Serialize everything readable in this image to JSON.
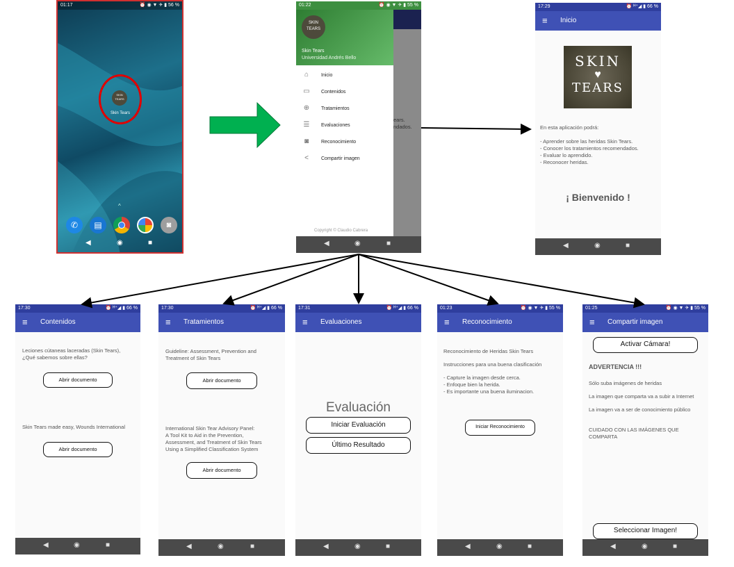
{
  "home": {
    "time": "01:17",
    "status_icons": "⏰ ◉ ▼ ✈ ▮ 56 %",
    "app_label": "Skin Tears",
    "logo_text": [
      "SKIN",
      "TEARS"
    ]
  },
  "drawer": {
    "time": "01:22",
    "status_icons": "⏰ ◉ ▼ ✈ ▮ 55 %",
    "app_name": "Skin Tears",
    "university": "Universidad Andrés Bello",
    "items": [
      {
        "label": "Inicio",
        "icon": "house-icon"
      },
      {
        "label": "Contenidos",
        "icon": "book-icon"
      },
      {
        "label": "Tratamientos",
        "icon": "target-icon"
      },
      {
        "label": "Evaluaciones",
        "icon": "checklist-icon"
      },
      {
        "label": "Reconocimiento",
        "icon": "camera-icon"
      },
      {
        "label": "Compartir imagen",
        "icon": "share-icon"
      }
    ],
    "behind_text": "ears.\nndados.",
    "copyright": "Copyright © Claudio Cabrera"
  },
  "inicio": {
    "time": "17:29",
    "status_icons": "⏰ ᴴ⁺◢ ▮ 66 %",
    "title": "Inicio",
    "logo_text": [
      "SKIN",
      "TEARS"
    ],
    "intro": "En esta aplicación podrá:",
    "bullets": "- Aprender sobre las heridas Skin Tears.\n- Conocer los tratamientos recomendados.\n- Evaluar lo aprendido.\n- Reconocer heridas.",
    "welcome": "¡ Bienvenido !"
  },
  "contenidos": {
    "time": "17:30",
    "status_icons": "⏰ ᴴ⁺◢ ▮ 66 %",
    "title": "Contenidos",
    "text1": "Leciones cútaneas laceradas (Skin Tears),\n¿Qué sabemos sobre ellas?",
    "button1": "Abrir documento",
    "text2": "Skin Tears made easy, Wounds International",
    "button2": "Abrir documento"
  },
  "tratamientos": {
    "time": "17:30",
    "status_icons": "⏰ ᴴ⁺◢ ▮ 66 %",
    "title": "Tratamientos",
    "text1": "Guideline: Assessment, Prevention and\nTreatment of Skin Tears",
    "button1": "Abrir documento",
    "text2": "International Skin Tear Advisory Panel:\nA Tool Kit to Aid in the Prevention,\nAssessment, and Treatment of Skin Tears\nUsing a Simplified Classification System",
    "button2": "Abrir documento"
  },
  "evaluaciones": {
    "time": "17:31",
    "status_icons": "⏰ ᴴ⁺◢ ▮ 66 %",
    "title": "Evaluaciones",
    "heading": "Evaluación",
    "button1": "Iniciar Evaluación",
    "button2": "Último Resultado"
  },
  "reconocimiento": {
    "time": "01:23",
    "status_icons": "⏰ ◉ ▼ ✈ ▮ 55 %",
    "title": "Reconocimiento",
    "text1": "Reconocimiento de Heridas Skin Tears",
    "text2": "Instrucciones para una buena clasificación",
    "bullets": "- Capture la imagen desde cerca.\n- Enfoque bien la herida.\n- Es importante una buena iluminacion.",
    "button": "Iniciar Reconocimiento"
  },
  "compartir": {
    "time": "01:25",
    "status_icons": "⏰ ◉ ▼ ✈ ▮ 55 %",
    "title": "Compartir imagen",
    "button_camera": "Activar Cámara!",
    "warning": "ADVERTENCIA !!!",
    "line1": "Sólo suba imágenes de heridas",
    "line2": "La imagen que comparta va a subir a Internet",
    "line3": "La imagen va a ser de conocimiento público",
    "caution": "CUIDADO CON LAS IMÁGENES QUE\nCOMPARTA",
    "button_select": "Seleccionar Imagen!"
  },
  "nav_icons": [
    "◀",
    "◉",
    "■"
  ],
  "colors": {
    "appbar": "#3f51b5",
    "statusbar": "#2f3e9e",
    "drawer_header": "#4caf50",
    "arrow_green": "#00b050",
    "highlight_red": "#e00000"
  }
}
